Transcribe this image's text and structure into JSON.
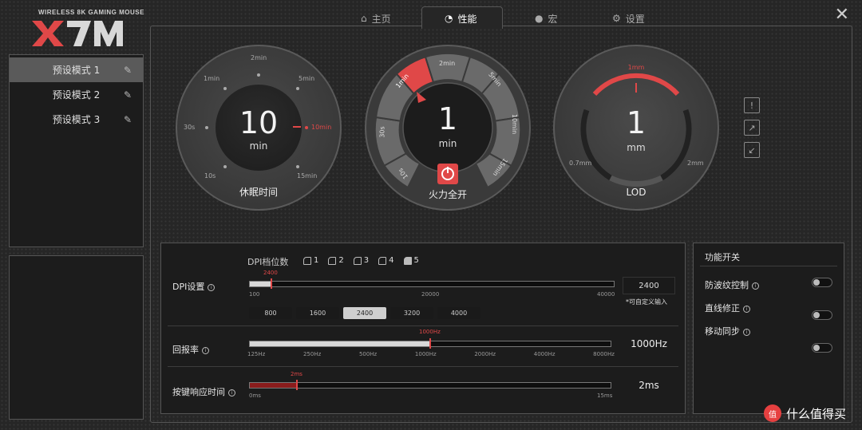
{
  "app": {
    "subtitle": "WIRELESS 8K GAMING MOUSE",
    "logo_text": "X7M"
  },
  "tabs": [
    {
      "label": "主页",
      "icon": "home-icon"
    },
    {
      "label": "性能",
      "icon": "gauge-icon"
    },
    {
      "label": "宏",
      "icon": "bulb-icon"
    },
    {
      "label": "设置",
      "icon": "gear-icon"
    }
  ],
  "active_tab": "性能",
  "presets": [
    {
      "label": "预设模式 1",
      "active": true
    },
    {
      "label": "预设模式 2",
      "active": false
    },
    {
      "label": "预设模式 3",
      "active": false
    }
  ],
  "sleep_dial": {
    "value": "10",
    "unit": "min",
    "label": "休眠时间",
    "ticks": {
      "t2": "2min",
      "t1": "1min",
      "t5": "5min",
      "t30s": "30s",
      "t10m": "10min",
      "t10s": "10s",
      "t15": "15min"
    }
  },
  "fire_dial": {
    "value": "1",
    "unit": "min",
    "label": "火力全开",
    "segments": {
      "s1": "1min",
      "s2": "2min",
      "s5": "5min",
      "s10": "10min",
      "s15": "15min",
      "s10s": "10s",
      "s30s": "30s"
    }
  },
  "lod_dial": {
    "value": "1",
    "unit": "mm",
    "label": "LOD",
    "selected": "1mm",
    "min": "0.7mm",
    "max": "2mm"
  },
  "dpi": {
    "count_label": "DPI档位数",
    "counts": [
      "1",
      "2",
      "3",
      "4",
      "5"
    ],
    "selected_count": "5",
    "setting_label": "DPI设置",
    "value": "2400",
    "min": "100",
    "mid": "20000",
    "max": "40000",
    "slider_fraction": 0.06,
    "box_value": "2400",
    "note": "*可自定义输入",
    "levels": [
      "800",
      "1600",
      "2400",
      "3200",
      "4000"
    ],
    "selected_level": "2400"
  },
  "polling": {
    "label": "回报率",
    "value": "1000Hz",
    "marker": "1000Hz",
    "ticks": [
      "125Hz",
      "250Hz",
      "500Hz",
      "1000Hz",
      "2000Hz",
      "4000Hz",
      "8000Hz"
    ],
    "slider_fraction": 0.5
  },
  "response": {
    "label": "按键响应时间",
    "value": "2ms",
    "marker": "2ms",
    "min": "0ms",
    "max": "15ms",
    "slider_fraction": 0.13
  },
  "features": {
    "title": "功能开关",
    "items": [
      {
        "label": "防波纹控制",
        "on": false
      },
      {
        "label": "直线修正",
        "on": false
      },
      {
        "label": "移动同步",
        "on": false
      }
    ]
  },
  "watermark": {
    "text": "什么值得买",
    "badge": "值"
  },
  "colors": {
    "accent": "#e04848",
    "panel": "#1c1c1c",
    "border": "#555555"
  }
}
